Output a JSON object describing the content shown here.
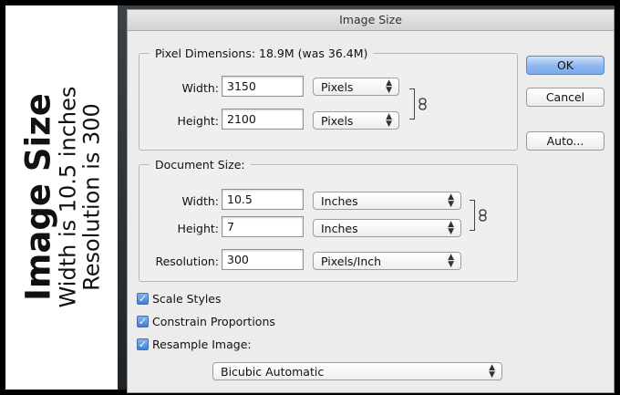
{
  "side_panel": {
    "title": "Image Size",
    "line1": "Width is 10.5 inches",
    "line2": "Resolution is 300"
  },
  "dialog": {
    "title": "Image Size",
    "pixel_dimensions": {
      "legend": "Pixel Dimensions:  18.9M (was 36.4M)",
      "width_label": "Width:",
      "width_value": "3150",
      "width_unit": "Pixels",
      "height_label": "Height:",
      "height_value": "2100",
      "height_unit": "Pixels"
    },
    "document_size": {
      "legend": "Document Size:",
      "width_label": "Width:",
      "width_value": "10.5",
      "width_unit": "Inches",
      "height_label": "Height:",
      "height_value": "7",
      "height_unit": "Inches",
      "resolution_label": "Resolution:",
      "resolution_value": "300",
      "resolution_unit": "Pixels/Inch"
    },
    "options": {
      "scale_styles": "Scale Styles",
      "constrain_proportions": "Constrain Proportions",
      "resample_image": "Resample Image:",
      "resample_method": "Bicubic Automatic"
    },
    "buttons": {
      "ok": "OK",
      "cancel": "Cancel",
      "auto": "Auto..."
    }
  },
  "colors": {
    "accent": "#7aaaee",
    "dialog_bg": "#ececec"
  }
}
